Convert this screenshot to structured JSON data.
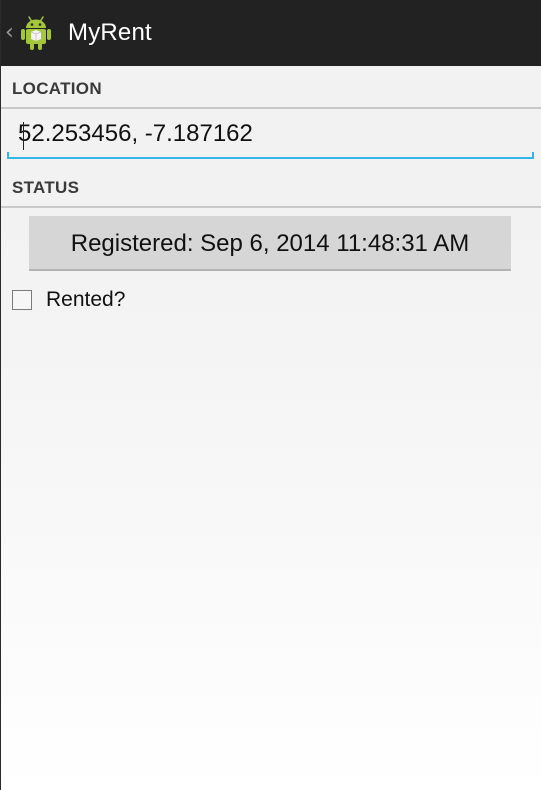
{
  "action_bar": {
    "title": "MyRent",
    "up_icon": "chevron-left-icon",
    "app_icon": "android-robot-icon",
    "background_color": "#222222"
  },
  "location": {
    "header": "LOCATION",
    "value": "52.253456, -7.187162",
    "underline_color": "#33b5e5"
  },
  "status": {
    "header": "STATUS",
    "date_button_label": "Registered: Sep 6, 2014 11:48:31 AM",
    "rented_label": "Rented?",
    "rented_checked": false
  }
}
